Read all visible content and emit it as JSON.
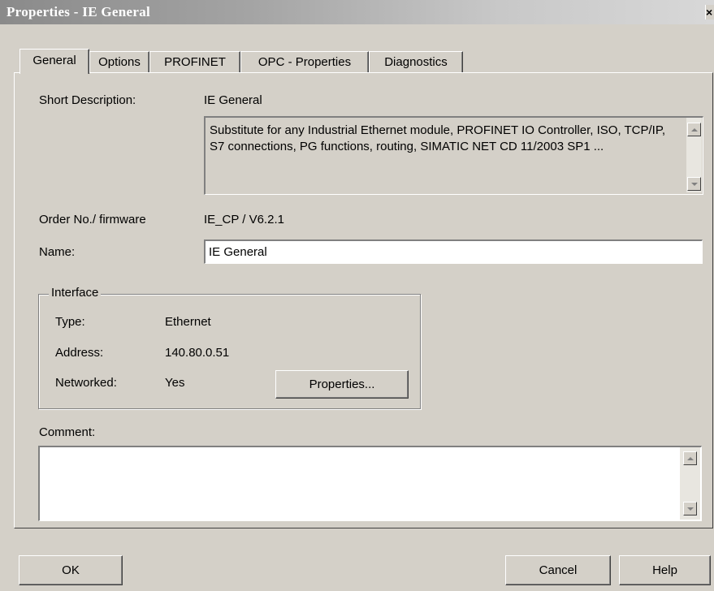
{
  "window": {
    "title": "Properties - IE General",
    "close_glyph": "×"
  },
  "tabs": [
    {
      "label": "General",
      "active": true
    },
    {
      "label": "Options",
      "active": false
    },
    {
      "label": "PROFINET",
      "active": false
    },
    {
      "label": "OPC - Properties",
      "active": false
    },
    {
      "label": "Diagnostics",
      "active": false
    }
  ],
  "general": {
    "short_description_label": "Short Description:",
    "short_description_value": "IE General",
    "description_text": "Substitute for any Industrial Ethernet module, PROFINET IO Controller, ISO, TCP/IP, S7 connections, PG functions, routing, SIMATIC NET CD 11/2003 SP1 ...",
    "order_label": "Order No./ firmware",
    "order_value": "IE_CP / V6.2.1",
    "name_label": "Name:",
    "name_value": "IE General",
    "interface": {
      "legend": "Interface",
      "type_label": "Type:",
      "type_value": "Ethernet",
      "address_label": "Address:",
      "address_value": "140.80.0.51",
      "networked_label": "Networked:",
      "networked_value": "Yes",
      "properties_button": "Properties..."
    },
    "comment_label": "Comment:",
    "comment_value": ""
  },
  "footer": {
    "ok_label": "OK",
    "cancel_label": "Cancel",
    "help_label": "Help"
  },
  "icons": {
    "scroll_up": "scroll-up-arrow-icon",
    "scroll_down": "scroll-down-arrow-icon"
  }
}
